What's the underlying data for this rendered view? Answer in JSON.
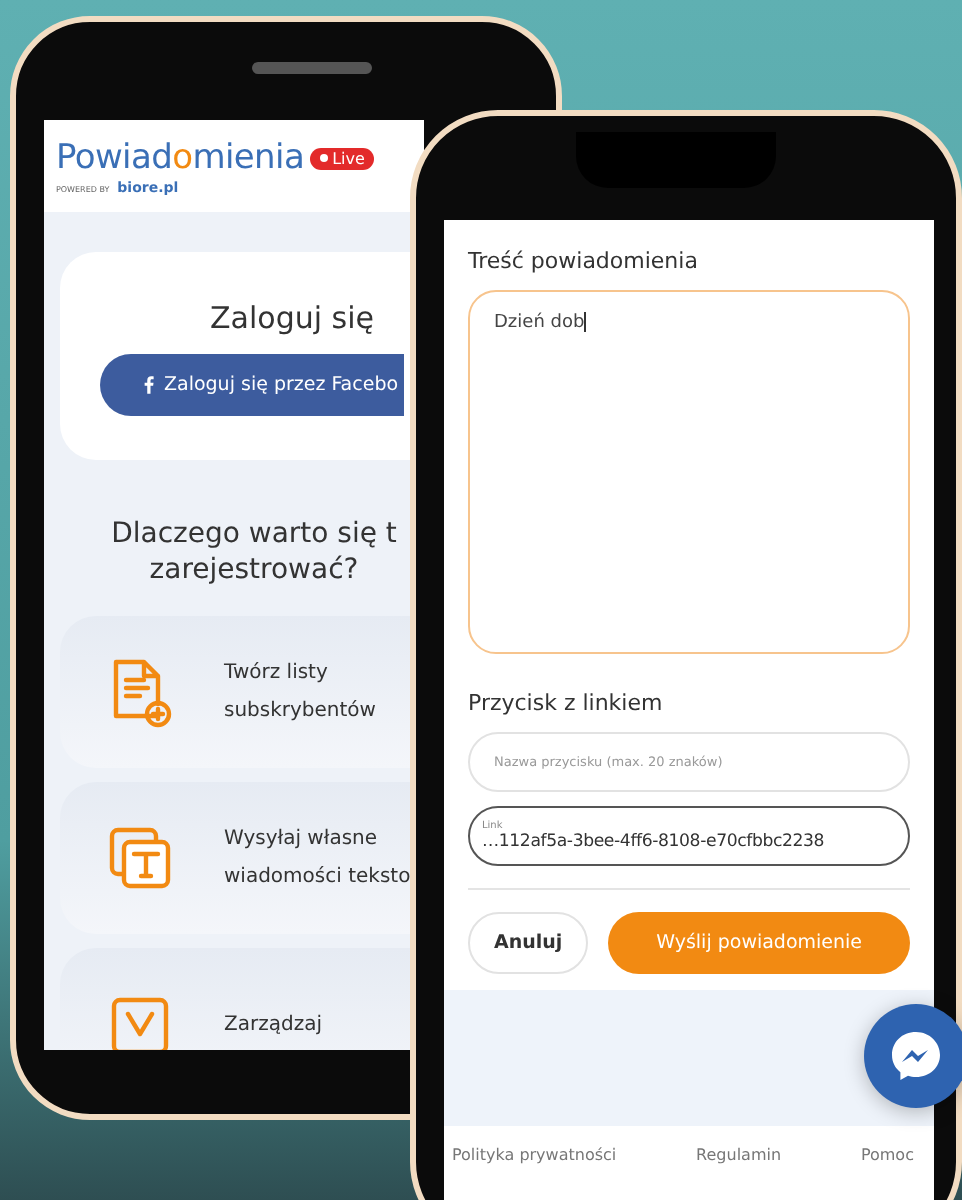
{
  "back_phone": {
    "logo": {
      "title_parts": [
        {
          "text": "Powiad",
          "accent": false
        },
        {
          "text": "o",
          "accent": true
        },
        {
          "text": "mienia",
          "accent": false
        }
      ],
      "badge": "Live",
      "powered_by": "POWERED BY",
      "brand": "biore.pl"
    },
    "login_card": {
      "title": "Zaloguj się",
      "facebook_button": "Zaloguj się przez Facebo"
    },
    "why_heading": [
      "Dlaczego warto się t",
      "zarejestrować?"
    ],
    "features": [
      {
        "kind": "list",
        "lines": [
          "Twórz listy",
          "subskrybentów"
        ]
      },
      {
        "kind": "text",
        "lines": [
          "Wysyłaj własne",
          "wiadomości teksto"
        ]
      },
      {
        "kind": "manage",
        "lines": [
          "Zarządzaj"
        ]
      }
    ]
  },
  "front_phone": {
    "message_label": "Treść powiadomienia",
    "message_field": {
      "value": "Dzień dob",
      "focused": true
    },
    "link_section_label": "Przycisk z linkiem",
    "button_name_field": {
      "placeholder": "Nazwa przycisku (max. 20 znaków)",
      "focused": false
    },
    "link_field": {
      "label": "Link",
      "value": "…112af5a-3bee-4ff6-8108-e70cfbbc2238",
      "focused": false
    },
    "cancel_button": "Anuluj",
    "send_button": "Wyślij powiadomienie",
    "footer_links": [
      "Polityka prywatności",
      "Regulamin",
      "Pomoc"
    ]
  }
}
